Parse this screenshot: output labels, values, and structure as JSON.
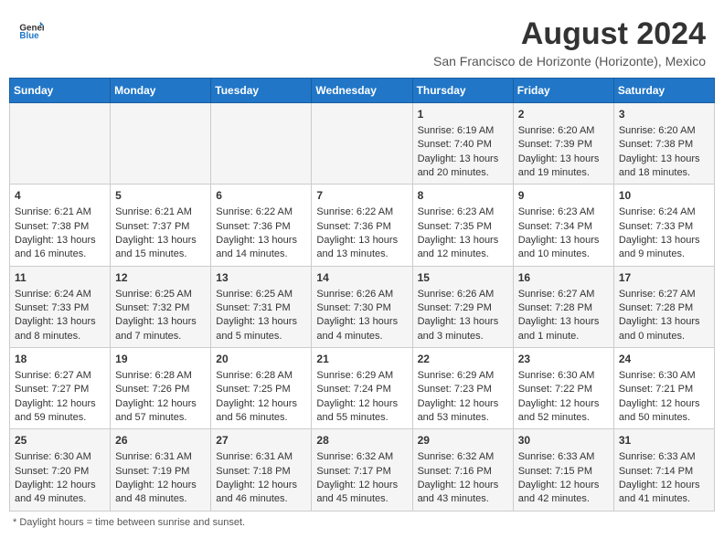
{
  "header": {
    "logo_line1": "General",
    "logo_line2": "Blue",
    "month_title": "August 2024",
    "location": "San Francisco de Horizonte (Horizonte), Mexico"
  },
  "days_of_week": [
    "Sunday",
    "Monday",
    "Tuesday",
    "Wednesday",
    "Thursday",
    "Friday",
    "Saturday"
  ],
  "weeks": [
    [
      {
        "day": "",
        "sunrise": "",
        "sunset": "",
        "daylight": ""
      },
      {
        "day": "",
        "sunrise": "",
        "sunset": "",
        "daylight": ""
      },
      {
        "day": "",
        "sunrise": "",
        "sunset": "",
        "daylight": ""
      },
      {
        "day": "",
        "sunrise": "",
        "sunset": "",
        "daylight": ""
      },
      {
        "day": "1",
        "sunrise": "Sunrise: 6:19 AM",
        "sunset": "Sunset: 7:40 PM",
        "daylight": "Daylight: 13 hours and 20 minutes."
      },
      {
        "day": "2",
        "sunrise": "Sunrise: 6:20 AM",
        "sunset": "Sunset: 7:39 PM",
        "daylight": "Daylight: 13 hours and 19 minutes."
      },
      {
        "day": "3",
        "sunrise": "Sunrise: 6:20 AM",
        "sunset": "Sunset: 7:38 PM",
        "daylight": "Daylight: 13 hours and 18 minutes."
      }
    ],
    [
      {
        "day": "4",
        "sunrise": "Sunrise: 6:21 AM",
        "sunset": "Sunset: 7:38 PM",
        "daylight": "Daylight: 13 hours and 16 minutes."
      },
      {
        "day": "5",
        "sunrise": "Sunrise: 6:21 AM",
        "sunset": "Sunset: 7:37 PM",
        "daylight": "Daylight: 13 hours and 15 minutes."
      },
      {
        "day": "6",
        "sunrise": "Sunrise: 6:22 AM",
        "sunset": "Sunset: 7:36 PM",
        "daylight": "Daylight: 13 hours and 14 minutes."
      },
      {
        "day": "7",
        "sunrise": "Sunrise: 6:22 AM",
        "sunset": "Sunset: 7:36 PM",
        "daylight": "Daylight: 13 hours and 13 minutes."
      },
      {
        "day": "8",
        "sunrise": "Sunrise: 6:23 AM",
        "sunset": "Sunset: 7:35 PM",
        "daylight": "Daylight: 13 hours and 12 minutes."
      },
      {
        "day": "9",
        "sunrise": "Sunrise: 6:23 AM",
        "sunset": "Sunset: 7:34 PM",
        "daylight": "Daylight: 13 hours and 10 minutes."
      },
      {
        "day": "10",
        "sunrise": "Sunrise: 6:24 AM",
        "sunset": "Sunset: 7:33 PM",
        "daylight": "Daylight: 13 hours and 9 minutes."
      }
    ],
    [
      {
        "day": "11",
        "sunrise": "Sunrise: 6:24 AM",
        "sunset": "Sunset: 7:33 PM",
        "daylight": "Daylight: 13 hours and 8 minutes."
      },
      {
        "day": "12",
        "sunrise": "Sunrise: 6:25 AM",
        "sunset": "Sunset: 7:32 PM",
        "daylight": "Daylight: 13 hours and 7 minutes."
      },
      {
        "day": "13",
        "sunrise": "Sunrise: 6:25 AM",
        "sunset": "Sunset: 7:31 PM",
        "daylight": "Daylight: 13 hours and 5 minutes."
      },
      {
        "day": "14",
        "sunrise": "Sunrise: 6:26 AM",
        "sunset": "Sunset: 7:30 PM",
        "daylight": "Daylight: 13 hours and 4 minutes."
      },
      {
        "day": "15",
        "sunrise": "Sunrise: 6:26 AM",
        "sunset": "Sunset: 7:29 PM",
        "daylight": "Daylight: 13 hours and 3 minutes."
      },
      {
        "day": "16",
        "sunrise": "Sunrise: 6:27 AM",
        "sunset": "Sunset: 7:28 PM",
        "daylight": "Daylight: 13 hours and 1 minute."
      },
      {
        "day": "17",
        "sunrise": "Sunrise: 6:27 AM",
        "sunset": "Sunset: 7:28 PM",
        "daylight": "Daylight: 13 hours and 0 minutes."
      }
    ],
    [
      {
        "day": "18",
        "sunrise": "Sunrise: 6:27 AM",
        "sunset": "Sunset: 7:27 PM",
        "daylight": "Daylight: 12 hours and 59 minutes."
      },
      {
        "day": "19",
        "sunrise": "Sunrise: 6:28 AM",
        "sunset": "Sunset: 7:26 PM",
        "daylight": "Daylight: 12 hours and 57 minutes."
      },
      {
        "day": "20",
        "sunrise": "Sunrise: 6:28 AM",
        "sunset": "Sunset: 7:25 PM",
        "daylight": "Daylight: 12 hours and 56 minutes."
      },
      {
        "day": "21",
        "sunrise": "Sunrise: 6:29 AM",
        "sunset": "Sunset: 7:24 PM",
        "daylight": "Daylight: 12 hours and 55 minutes."
      },
      {
        "day": "22",
        "sunrise": "Sunrise: 6:29 AM",
        "sunset": "Sunset: 7:23 PM",
        "daylight": "Daylight: 12 hours and 53 minutes."
      },
      {
        "day": "23",
        "sunrise": "Sunrise: 6:30 AM",
        "sunset": "Sunset: 7:22 PM",
        "daylight": "Daylight: 12 hours and 52 minutes."
      },
      {
        "day": "24",
        "sunrise": "Sunrise: 6:30 AM",
        "sunset": "Sunset: 7:21 PM",
        "daylight": "Daylight: 12 hours and 50 minutes."
      }
    ],
    [
      {
        "day": "25",
        "sunrise": "Sunrise: 6:30 AM",
        "sunset": "Sunset: 7:20 PM",
        "daylight": "Daylight: 12 hours and 49 minutes."
      },
      {
        "day": "26",
        "sunrise": "Sunrise: 6:31 AM",
        "sunset": "Sunset: 7:19 PM",
        "daylight": "Daylight: 12 hours and 48 minutes."
      },
      {
        "day": "27",
        "sunrise": "Sunrise: 6:31 AM",
        "sunset": "Sunset: 7:18 PM",
        "daylight": "Daylight: 12 hours and 46 minutes."
      },
      {
        "day": "28",
        "sunrise": "Sunrise: 6:32 AM",
        "sunset": "Sunset: 7:17 PM",
        "daylight": "Daylight: 12 hours and 45 minutes."
      },
      {
        "day": "29",
        "sunrise": "Sunrise: 6:32 AM",
        "sunset": "Sunset: 7:16 PM",
        "daylight": "Daylight: 12 hours and 43 minutes."
      },
      {
        "day": "30",
        "sunrise": "Sunrise: 6:33 AM",
        "sunset": "Sunset: 7:15 PM",
        "daylight": "Daylight: 12 hours and 42 minutes."
      },
      {
        "day": "31",
        "sunrise": "Sunrise: 6:33 AM",
        "sunset": "Sunset: 7:14 PM",
        "daylight": "Daylight: 12 hours and 41 minutes."
      }
    ]
  ],
  "footer": "* Daylight hours = time between sunrise and sunset."
}
